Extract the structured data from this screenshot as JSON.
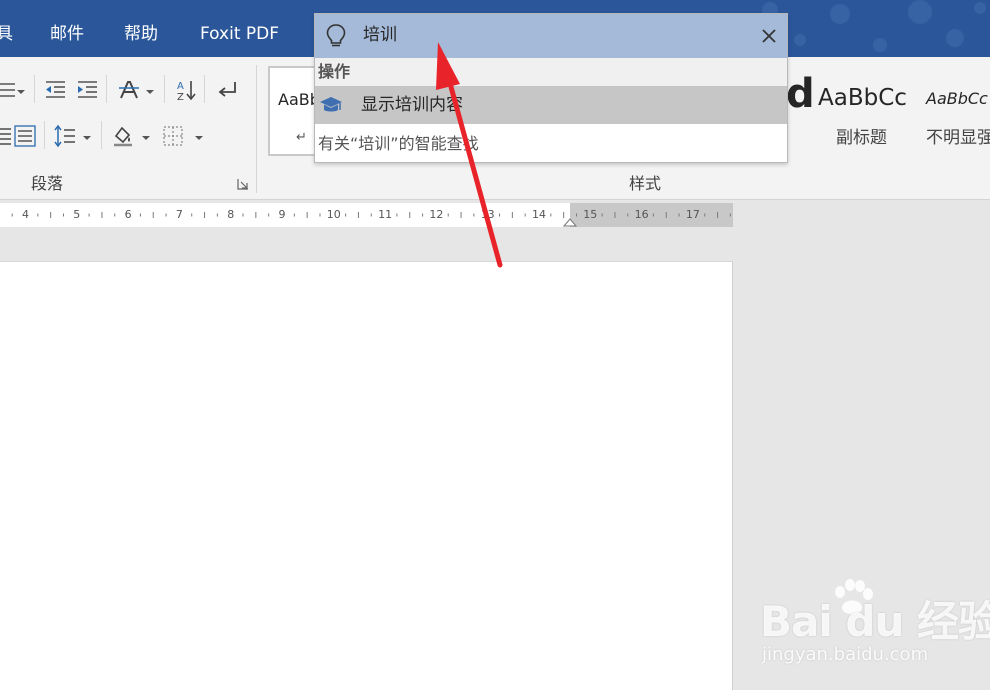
{
  "menu": {
    "items": [
      {
        "label": "具"
      },
      {
        "label": "邮件"
      },
      {
        "label": "帮助"
      },
      {
        "label": "Foxit PDF"
      }
    ]
  },
  "ribbon": {
    "paragraph_group_label": "段落",
    "styles_group_label": "样式",
    "styles": [
      {
        "sample": "AaBb",
        "name": ""
      },
      {
        "sample": "d",
        "name": ""
      },
      {
        "sample": "AaBbCc",
        "name": "副标题"
      },
      {
        "sample": "AaBbCc",
        "name": "不明显强"
      }
    ],
    "paragraph_mark": "↵"
  },
  "ruler": {
    "numbers": [
      "4",
      "5",
      "6",
      "7",
      "8",
      "9",
      "10",
      "11",
      "12",
      "13",
      "14",
      "15",
      "16",
      "17"
    ]
  },
  "tellme": {
    "query": "培训",
    "section_header": "操作",
    "result_label": "显示培训内容",
    "smart_lookup_label": "有关“培训”的智能查找"
  },
  "watermark": {
    "logo_text": "Bai du 经验",
    "url": "jingyan.baidu.com"
  },
  "colors": {
    "title_bar": "#2b579a",
    "search_header": "#a4bad8",
    "selected_row": "#c6c6c6",
    "arrow": "#e8232a"
  }
}
